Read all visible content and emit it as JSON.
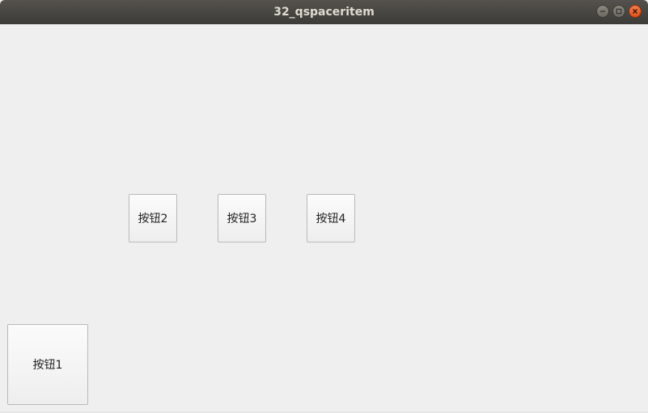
{
  "window": {
    "title": "32_qspaceritem",
    "controls": {
      "minimize_icon": "minimize-icon",
      "maximize_icon": "maximize-icon",
      "close_icon": "close-icon"
    }
  },
  "buttons": {
    "b1": "按钮1",
    "b2": "按钮2",
    "b3": "按钮3",
    "b4": "按钮4"
  },
  "colors": {
    "titlebar": "#3c3b37",
    "background": "#efefef",
    "close_accent": "#e0521f"
  }
}
